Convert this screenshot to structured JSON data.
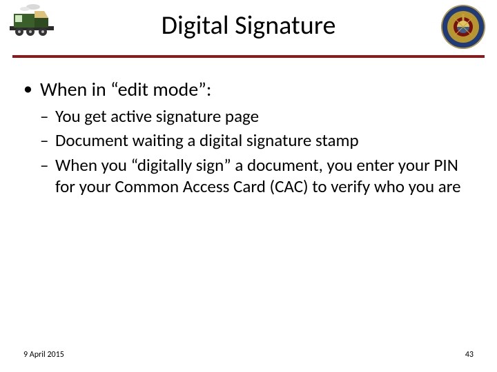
{
  "title": "Digital Signature",
  "bullets": {
    "item0": {
      "text": "When in “edit mode”:",
      "sub": {
        "s0": "You get active signature page",
        "s1": "Document waiting a digital signature stamp",
        "s2": "When you “digitally sign” a document, you enter your PIN for your Common Access Card (CAC) to verify who you are"
      }
    }
  },
  "footer": {
    "date": "9 April 2015",
    "page": "43"
  },
  "icons": {
    "left": "train-clipart-icon",
    "right": "usmc-seal-icon"
  },
  "colors": {
    "rule": "#8b1a1a",
    "seal_outer": "#1f3b7a",
    "seal_inner": "#b7952f",
    "seal_center": "#7a0f0f"
  }
}
